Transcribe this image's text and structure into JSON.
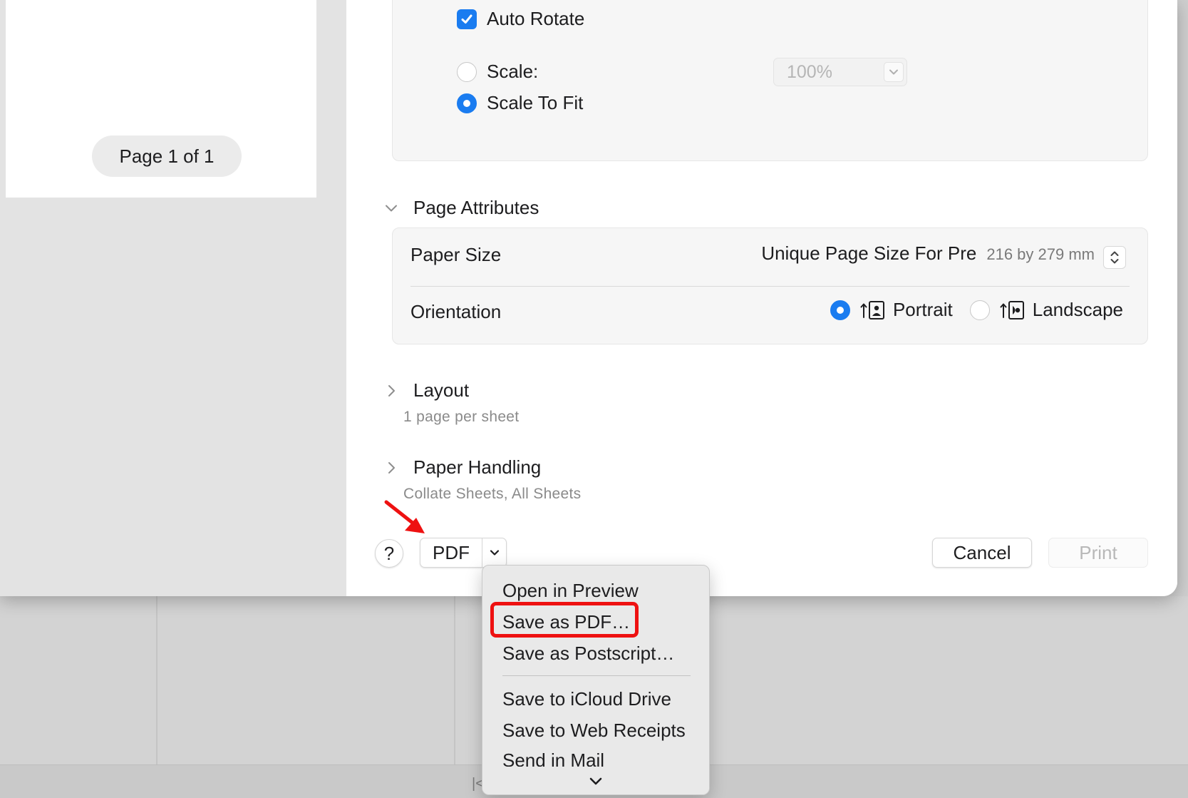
{
  "preview": {
    "page_indicator": "Page 1 of 1"
  },
  "options": {
    "auto_rotate": {
      "label": "Auto Rotate",
      "checked": true
    },
    "scale": {
      "label": "Scale:",
      "value": "100%",
      "selected": false
    },
    "scale_to_fit": {
      "label": "Scale To Fit",
      "selected": true
    }
  },
  "page_attributes": {
    "title": "Page Attributes",
    "paper_size": {
      "label": "Paper Size",
      "value": "Unique Page Size For Pre",
      "dimensions": "216 by 279 mm"
    },
    "orientation": {
      "label": "Orientation",
      "portrait": {
        "label": "Portrait",
        "selected": true
      },
      "landscape": {
        "label": "Landscape",
        "selected": false
      }
    }
  },
  "layout": {
    "title": "Layout",
    "summary": "1 page per sheet"
  },
  "paper_handling": {
    "title": "Paper Handling",
    "summary": "Collate Sheets, All Sheets"
  },
  "footer": {
    "help_label": "?",
    "pdf_label": "PDF",
    "cancel_label": "Cancel",
    "print_label": "Print"
  },
  "pdf_menu": {
    "items": [
      "Open in Preview",
      "Save as PDF…",
      "Save as Postscript…",
      "Save to iCloud Drive",
      "Save to Web Receipts",
      "Send in Mail"
    ]
  },
  "colors": {
    "accent": "#1a7cf0",
    "annotation": "#ee1111"
  },
  "background": {
    "glyph": "|<"
  }
}
